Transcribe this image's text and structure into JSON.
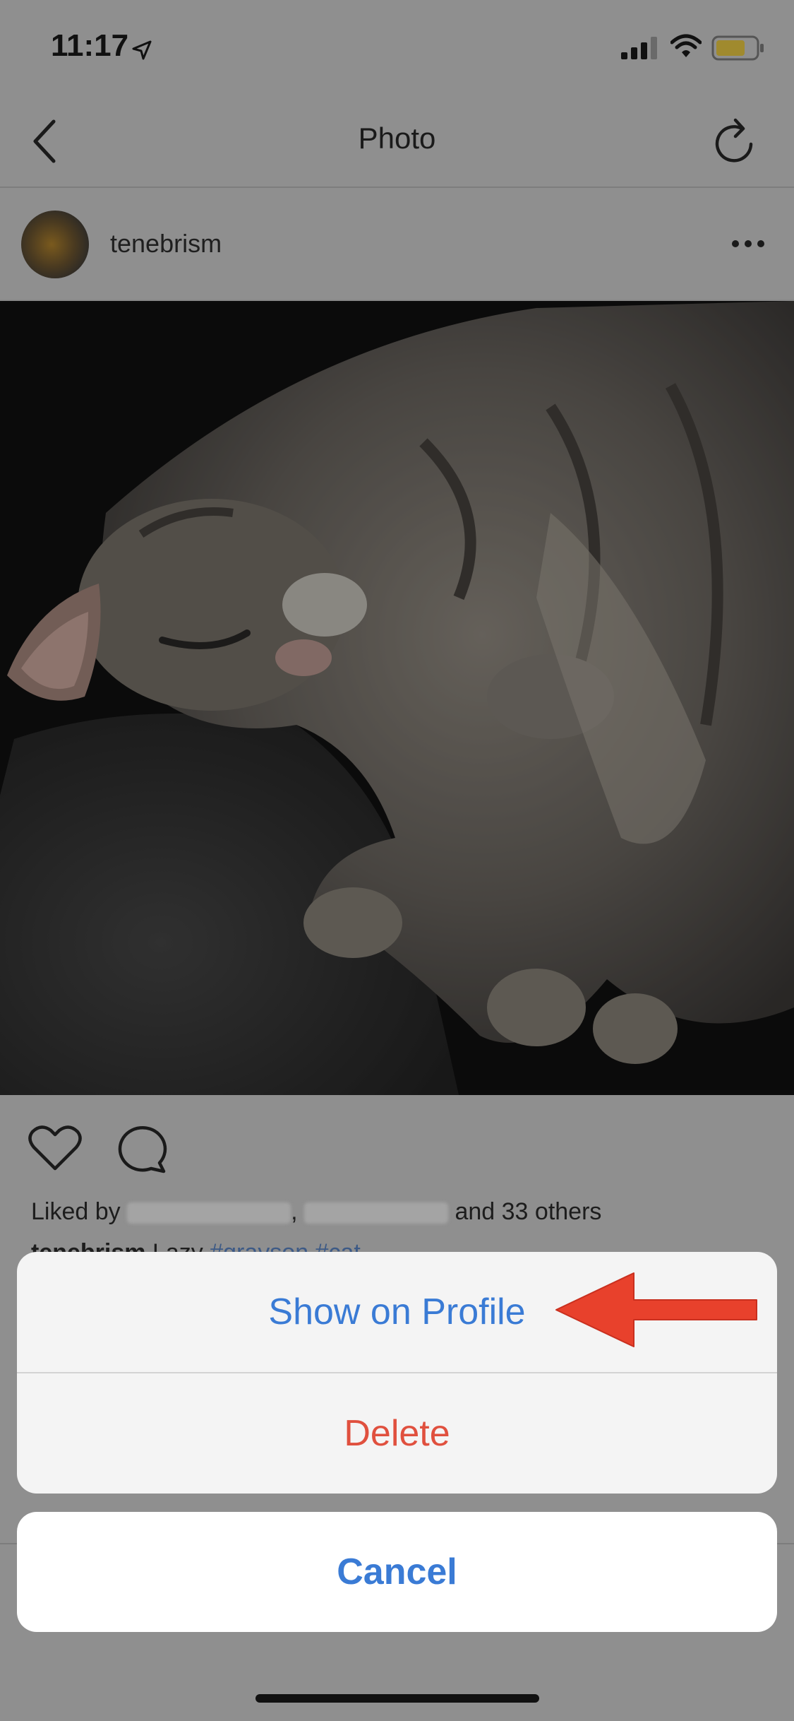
{
  "status_bar": {
    "time": "11:17"
  },
  "nav": {
    "title": "Photo"
  },
  "post": {
    "username": "tenebrism",
    "likes_prefix": "Liked by",
    "likes_separator": ",",
    "likes_suffix": "and",
    "likes_count": "33 others",
    "caption_user": "tenebrism",
    "caption_text": "Lazy",
    "caption_tags": "#grayson #cat"
  },
  "action_sheet": {
    "show_on_profile": "Show on Profile",
    "delete": "Delete",
    "cancel": "Cancel"
  },
  "colors": {
    "action_blue": "#3a7bd5",
    "destructive_red": "#e0503e",
    "annotation_arrow": "#e8412c"
  }
}
